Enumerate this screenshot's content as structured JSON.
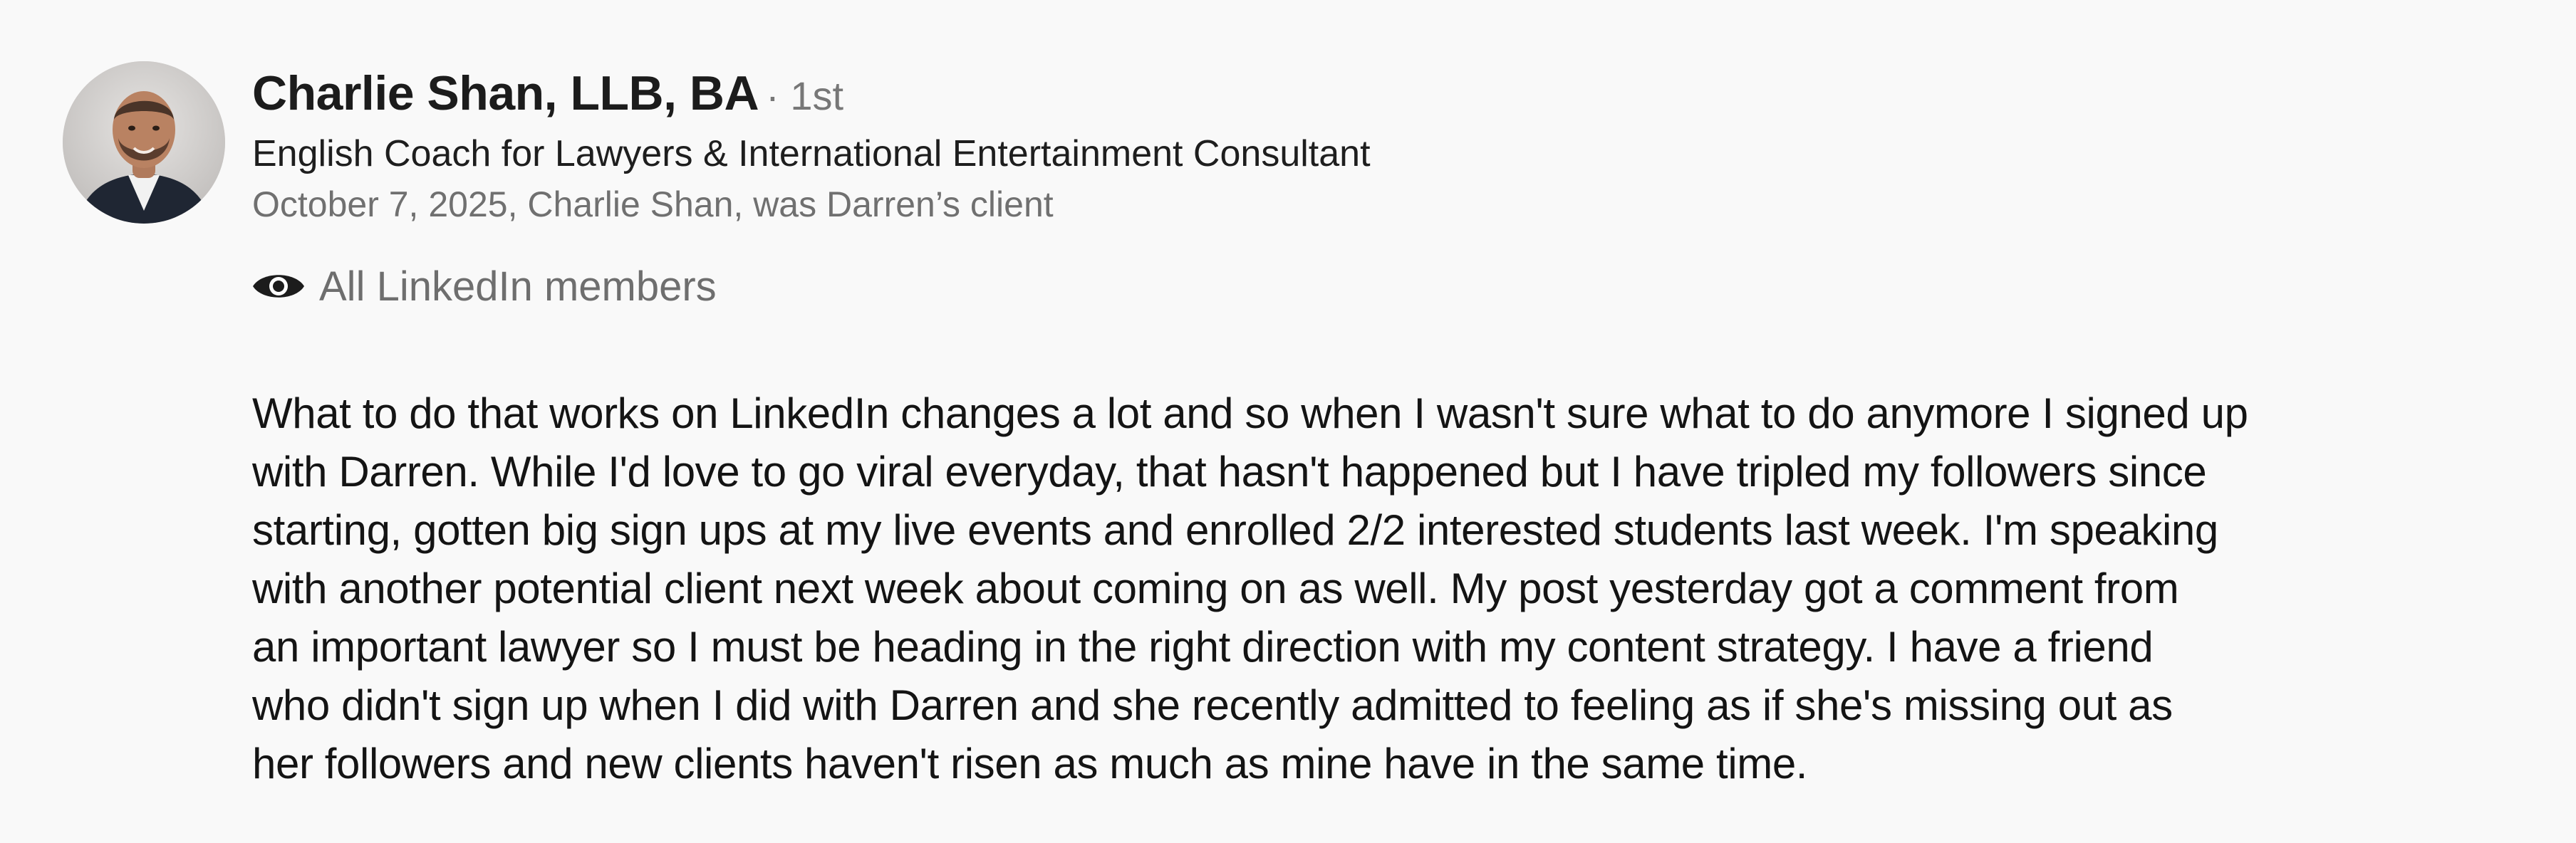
{
  "recommendation": {
    "author": {
      "name": "Charlie Shan, LLB, BA",
      "connection_degree": "· 1st",
      "headline": "English Coach for Lawyers & International Entertainment Consultant",
      "meta": "October 7, 2025, Charlie Shan, was Darren’s client",
      "avatar_icon": "profile-photo"
    },
    "visibility": {
      "icon": "eye-icon",
      "label": "All LinkedIn members"
    },
    "body_lines": [
      "What to do that works on LinkedIn changes a lot and so when I wasn't sure what to do anymore I signed up",
      "with Darren. While I'd love to go viral everyday, that hasn't happened but I have tripled my followers since",
      "starting, gotten big sign ups at my live events and enrolled 2/2 interested students last week. I'm speaking",
      "with another potential client next week about coming on as well. My post yesterday got a comment from",
      "an important lawyer so I must be heading in the right direction with my content strategy. I have a friend",
      "who didn't sign up when I did with Darren and she recently admitted to feeling as if she's missing out as",
      "her followers and new clients haven't risen as much as mine have in the same time."
    ]
  }
}
